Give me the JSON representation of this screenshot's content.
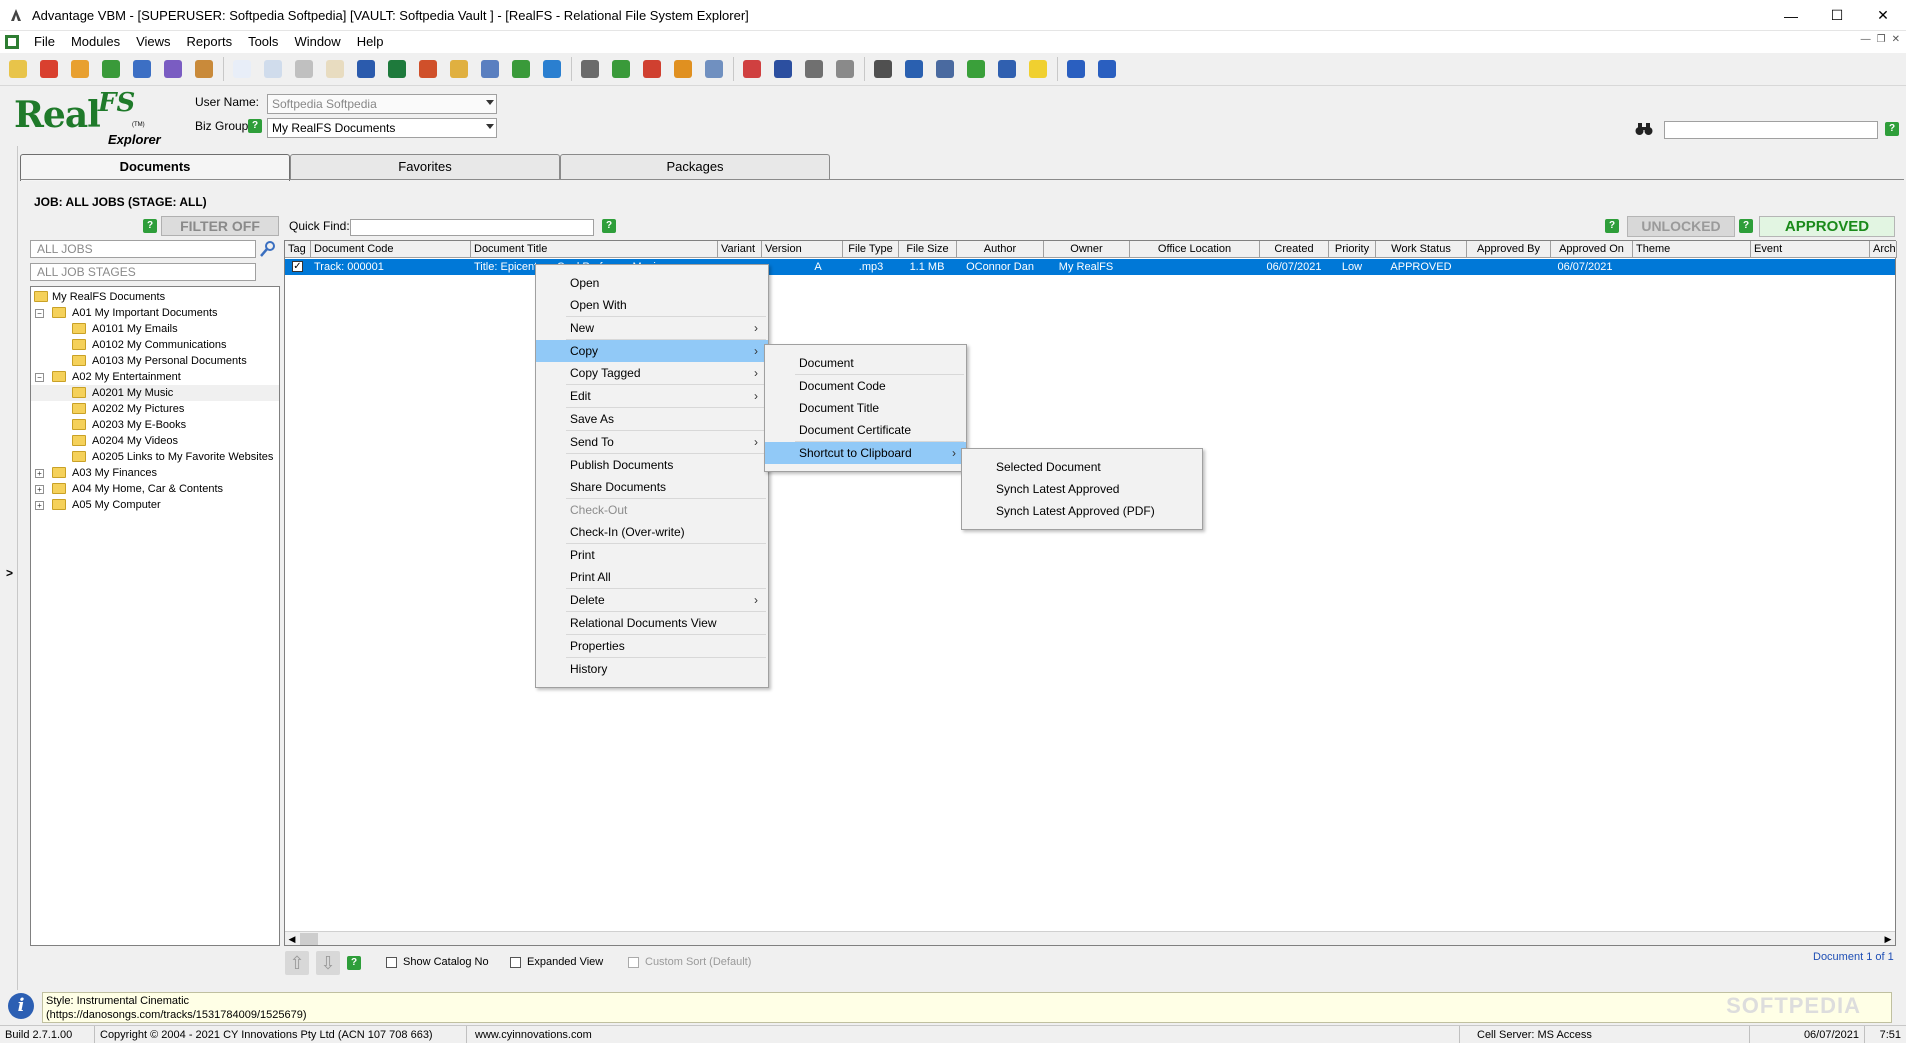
{
  "window": {
    "title": "Advantage VBM - [SUPERUSER: Softpedia Softpedia]  [VAULT: Softpedia Vault ] - [RealFS - Relational File System Explorer]",
    "minimize": "—",
    "maximize": "☐",
    "close": "✕"
  },
  "menu": {
    "items": [
      "File",
      "Modules",
      "Views",
      "Reports",
      "Tools",
      "Window",
      "Help"
    ]
  },
  "toolbar": {
    "icons": [
      {
        "name": "note-icon",
        "color": "#e8c44a"
      },
      {
        "name": "go-back-red-icon",
        "color": "#d9402f"
      },
      {
        "name": "go-orange-icon",
        "color": "#e8a030"
      },
      {
        "name": "go-green-icon",
        "color": "#3a9a3a"
      },
      {
        "name": "go-blue-icon",
        "color": "#3c6fc4"
      },
      {
        "name": "go-purple-icon",
        "color": "#7a5cc2"
      },
      {
        "name": "cabinet-icon",
        "color": "#c98a3a"
      },
      {
        "name": "new-document-icon",
        "color": "#e8eef8"
      },
      {
        "name": "copy-document-icon",
        "color": "#d0dcec"
      },
      {
        "name": "search-document-icon",
        "color": "#c0c0c0"
      },
      {
        "name": "edit-document-icon",
        "color": "#e8dcc0"
      },
      {
        "name": "word-icon",
        "color": "#2b5bad"
      },
      {
        "name": "excel-icon",
        "color": "#1e7a3c"
      },
      {
        "name": "powerpoint-icon",
        "color": "#d0502a"
      },
      {
        "name": "attach-icon",
        "color": "#e0b040"
      },
      {
        "name": "scan-icon",
        "color": "#5a7fc0"
      },
      {
        "name": "export-icon",
        "color": "#3a9a3a"
      },
      {
        "name": "globe-icon",
        "color": "#2a7fd0"
      },
      {
        "name": "barcode-icon",
        "color": "#6a6a6a"
      },
      {
        "name": "approve-document-icon",
        "color": "#3a9a3a"
      },
      {
        "name": "recycle-icon",
        "color": "#d04030"
      },
      {
        "name": "gears-icon",
        "color": "#e09020"
      },
      {
        "name": "email-icon",
        "color": "#7090c0"
      },
      {
        "name": "calendar-icon",
        "color": "#d04040"
      },
      {
        "name": "save-icon",
        "color": "#2c4fa0"
      },
      {
        "name": "print-icon",
        "color": "#707070"
      },
      {
        "name": "window-icon",
        "color": "#8a8a8a"
      },
      {
        "name": "keyboard-icon",
        "color": "#505050"
      },
      {
        "name": "clock-icon",
        "color": "#2a60b0"
      },
      {
        "name": "book-icon",
        "color": "#4a6aa0"
      },
      {
        "name": "refresh-icon",
        "color": "#3aa03a"
      },
      {
        "name": "pen-icon",
        "color": "#3060b0"
      },
      {
        "name": "lightbulb-icon",
        "color": "#f0d030"
      },
      {
        "name": "help-icon",
        "color": "#2a5fc0"
      },
      {
        "name": "help-context-icon",
        "color": "#2a5fc0"
      }
    ]
  },
  "header": {
    "logo_real": "Real",
    "logo_fs": "FS",
    "logo_tm": "(TM)",
    "logo_explorer": "Explorer",
    "user_label": "User Name:",
    "user_value": "Softpedia Softpedia",
    "bizgroup_label": "Biz Group",
    "bizgroup_value": "My RealFS Documents",
    "help": "?"
  },
  "tabs": [
    "Documents",
    "Favorites",
    "Packages"
  ],
  "job_title": "JOB: ALL JOBS (STAGE: ALL)",
  "filter_button": "FILTER OFF",
  "quick_find_label": "Quick Find:",
  "unlocked_label": "UNLOCKED",
  "approved_label": "APPROVED",
  "left_panel": {
    "jobs_placeholder": "ALL JOBS",
    "stages_placeholder": "ALL JOB STAGES",
    "side_arrow": ">"
  },
  "tree": [
    {
      "label": "My RealFS Documents",
      "level": 0,
      "exp": ""
    },
    {
      "label": "A01 My Important Documents",
      "level": 1,
      "exp": "−"
    },
    {
      "label": "A0101 My Emails",
      "level": 2,
      "exp": ""
    },
    {
      "label": "A0102 My Communications",
      "level": 2,
      "exp": ""
    },
    {
      "label": "A0103 My Personal Documents",
      "level": 2,
      "exp": ""
    },
    {
      "label": "A02 My Entertainment",
      "level": 1,
      "exp": "−"
    },
    {
      "label": "A0201 My Music",
      "level": 2,
      "exp": "",
      "selected": true
    },
    {
      "label": "A0202 My Pictures",
      "level": 2,
      "exp": ""
    },
    {
      "label": "A0203 My E-Books",
      "level": 2,
      "exp": ""
    },
    {
      "label": "A0204 My Videos",
      "level": 2,
      "exp": ""
    },
    {
      "label": "A0205 Links to My Favorite Websites",
      "level": 2,
      "exp": ""
    },
    {
      "label": "A03 My Finances",
      "level": 1,
      "exp": "+"
    },
    {
      "label": "A04 My Home, Car & Contents",
      "level": 1,
      "exp": "+"
    },
    {
      "label": "A05 My Computer",
      "level": 1,
      "exp": "+"
    }
  ],
  "grid": {
    "columns": [
      "Tag",
      "Document Code",
      "Document Title",
      "Variant",
      "Version",
      "File Type",
      "File Size",
      "Author",
      "Owner",
      "Office Location",
      "Created",
      "Priority",
      "Work Status",
      "Approved By",
      "Approved On",
      "Theme",
      "Event",
      "Arch"
    ],
    "row": {
      "tag_checked": "✓",
      "code": "Track: 000001",
      "title": "Title: Epicenter - Cool Professor Music",
      "variant": "",
      "version": "A",
      "file_type": ".mp3",
      "file_size": "1.1 MB",
      "author": "OConnor Dan",
      "owner": "My RealFS",
      "office": "",
      "created": "06/07/2021",
      "priority": "Low",
      "work_status": "APPROVED",
      "approved_by": "",
      "approved_on": "06/07/2021"
    },
    "scroll_left": "◀",
    "scroll_right": "▶"
  },
  "bottom": {
    "up_arrow": "⇧",
    "down_arrow": "⇩",
    "show_catalog": "Show Catalog No",
    "expanded_view": "Expanded View",
    "custom_sort": "Custom Sort (Default)",
    "doc_count": "Document 1 of 1"
  },
  "info": {
    "icon": "i",
    "line1": "Style: Instrumental Cinematic",
    "line2": "(https://danosongs.com/tracks/1531784009/1525679)",
    "watermark": "SOFTPEDIA"
  },
  "status": {
    "build": "Build 2.7.1.00",
    "copyright": "Copyright © 2004 - 2021 CY Innovations Pty Ltd  (ACN 107 708 663)",
    "website": "www.cyinnovations.com",
    "cell_server": "Cell Server: MS Access",
    "date": "06/07/2021",
    "time": "7:51"
  },
  "context_menu": {
    "items": [
      {
        "label": "Open"
      },
      {
        "label": "Open With",
        "sep_after": true
      },
      {
        "label": "New",
        "sub": true,
        "sep_after": true
      },
      {
        "label": "Copy",
        "sub": true,
        "highlight": true
      },
      {
        "label": "Copy Tagged",
        "sub": true,
        "sep_after": true
      },
      {
        "label": "Edit",
        "sub": true,
        "sep_after": true
      },
      {
        "label": "Save As",
        "sep_after": true
      },
      {
        "label": "Send To",
        "sub": true,
        "sep_after": true
      },
      {
        "label": "Publish Documents"
      },
      {
        "label": "Share Documents",
        "sep_after": true
      },
      {
        "label": "Check-Out",
        "disabled": true
      },
      {
        "label": "Check-In (Over-write)",
        "sep_after": true
      },
      {
        "label": "Print"
      },
      {
        "label": "Print All",
        "sep_after": true
      },
      {
        "label": "Delete",
        "sub": true,
        "sep_after": true
      },
      {
        "label": "Relational Documents View",
        "sep_after": true
      },
      {
        "label": "Properties",
        "sep_after": true
      },
      {
        "label": "History"
      }
    ]
  },
  "copy_submenu": {
    "items": [
      {
        "label": "Document",
        "sep_after": true
      },
      {
        "label": "Document Code"
      },
      {
        "label": "Document Title"
      },
      {
        "label": "Document Certificate",
        "sep_after": true
      },
      {
        "label": "Shortcut to Clipboard",
        "sub": true,
        "highlight": true
      }
    ]
  },
  "clipboard_submenu": {
    "items": [
      {
        "label": "Selected Document"
      },
      {
        "label": "Synch Latest Approved"
      },
      {
        "label": "Synch Latest Approved (PDF)"
      }
    ]
  },
  "submenu_arrow": "›"
}
